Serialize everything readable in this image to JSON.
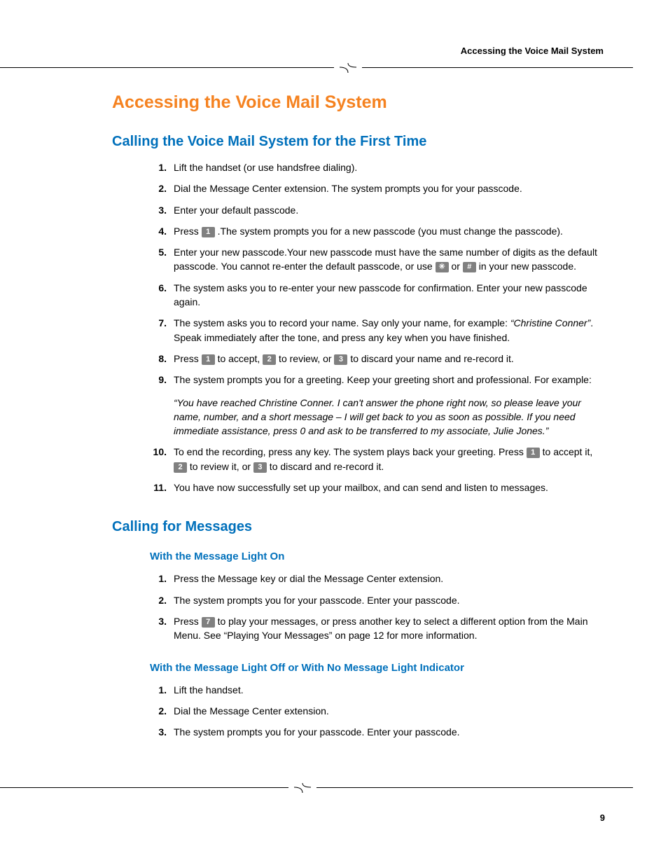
{
  "running_head": "Accessing the Voice Mail System",
  "h1": "Accessing the Voice Mail System",
  "h2a": "Calling the Voice Mail System for the First Time",
  "steps1": {
    "s1": "Lift the handset (or use handsfree dialing).",
    "s2": "Dial the Message Center extension. The system prompts you for your passcode.",
    "s3": "Enter your default passcode.",
    "s4a": "Press ",
    "s4b": " .The system prompts you for a new passcode (you must change the passcode).",
    "s5a": "Enter your new passcode.Your new passcode must have the same number of digits as the default passcode. You cannot re-enter the default passcode, or use ",
    "s5b": " or ",
    "s5c": " in your new passcode.",
    "s6": "The system asks you to re-enter your new passcode for confirmation. Enter your new passcode again.",
    "s7a": "The system asks you to record your name. Say only your name, for example: ",
    "s7b": "“Christine Conner”",
    "s7c": ". Speak immediately after the tone, and press any key when you have finished.",
    "s8a": "Press ",
    "s8b": " to accept, ",
    "s8c": " to review, or ",
    "s8d": " to discard your name and re-record it.",
    "s9a": "The system prompts you for a greeting. Keep your greeting short and professional. For example:",
    "s9q": "“You have reached Christine Conner. I can't answer the phone right now, so please leave your name, number, and a short message – I will get back to you as soon as possible. If you need immediate assistance, press 0 and ask to be transferred to my associate, Julie Jones.”",
    "s10a": "To end the recording, press any key. The system plays back your greeting. Press ",
    "s10b": " to accept it, ",
    "s10c": " to review it, or ",
    "s10d": " to discard and re-record it.",
    "s11": "You have now successfully set up your mailbox, and can send and listen to messages."
  },
  "h2b": "Calling for Messages",
  "h3a": "With the Message Light On",
  "steps2": {
    "s1": "Press the Message key or dial the Message Center extension.",
    "s2": "The system prompts you for your passcode. Enter your passcode.",
    "s3a": "Press ",
    "s3b": " to play your messages, or press another key to select a different option from the Main Menu. See “Playing Your Messages” on page 12 for more information."
  },
  "h3b": "With the Message Light Off or With No Message Light Indicator",
  "steps3": {
    "s1": "Lift the handset.",
    "s2": "Dial the Message Center extension.",
    "s3": "The system prompts you for your passcode. Enter your passcode."
  },
  "keys": {
    "one": "1",
    "two": "2",
    "three": "3",
    "seven": "7",
    "star": "✳",
    "hash": "#"
  },
  "pagenum": "9"
}
